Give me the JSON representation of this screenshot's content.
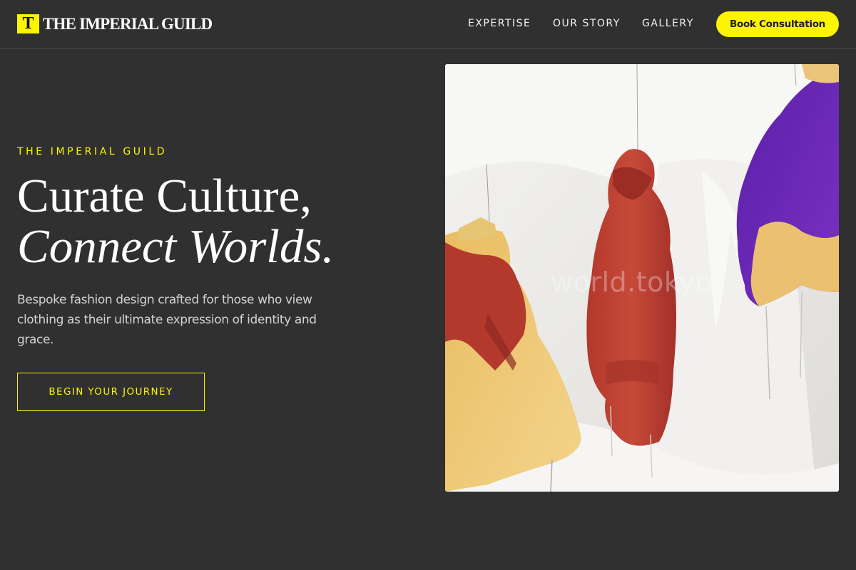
{
  "brand": {
    "mark": "T",
    "name": "THE IMPERIAL GUILD",
    "accent_color": "#fdf500",
    "background_color": "#303030"
  },
  "nav": {
    "items": [
      "EXPERTISE",
      "OUR STORY",
      "GALLERY"
    ],
    "cta_label": "Book Consultation"
  },
  "hero": {
    "eyebrow": "THE IMPERIAL GUILD",
    "headline_line1": "Curate Culture,",
    "headline_line2": "Connect Worlds.",
    "description": "Bespoke fashion design crafted for those who view clothing as their ultimate expression of identity and grace.",
    "cta_label": "BEGIN YOUR JOURNEY",
    "image": {
      "subject": "hanging-garments-photo",
      "watermark": "world.tokyo"
    }
  }
}
